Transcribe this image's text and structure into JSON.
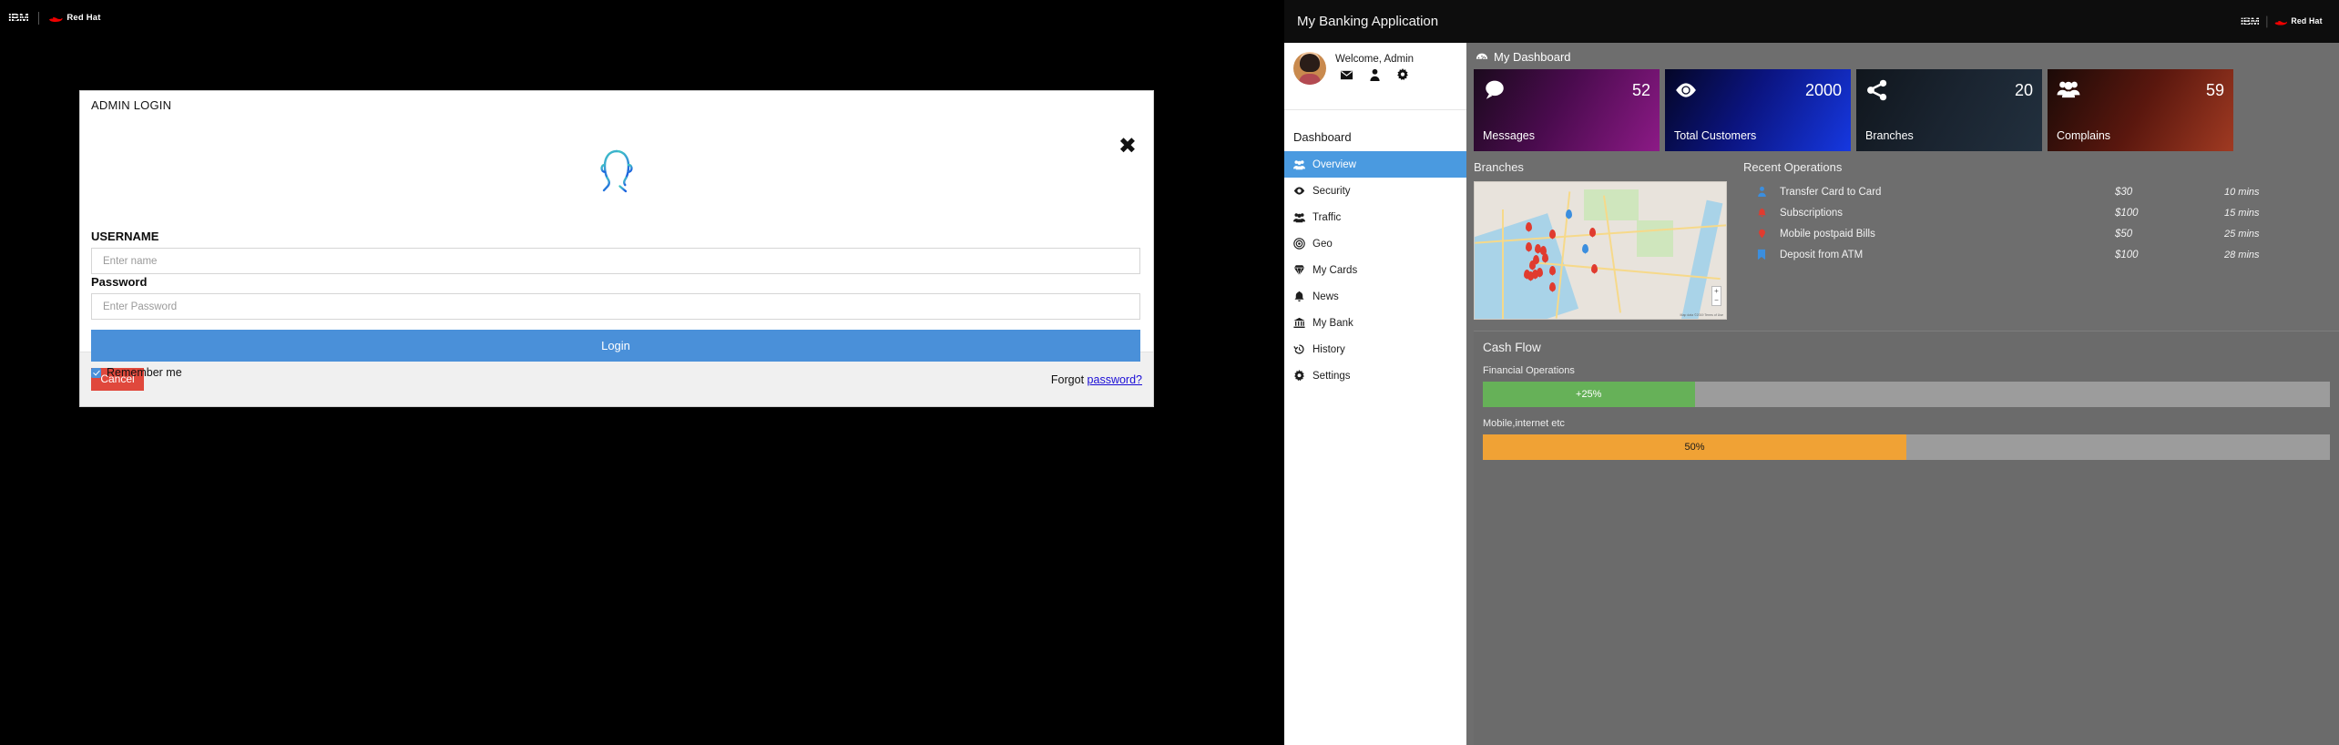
{
  "left_app": {
    "brand": {
      "ibm": "IBM",
      "redhat": "Red Hat"
    },
    "modal": {
      "title": "ADMIN LOGIN",
      "close_icon": "close-icon",
      "avatar_icon": "user-outline-icon",
      "username_label": "USERNAME",
      "username_value": "",
      "username_placeholder": "Enter name",
      "password_label": "Password",
      "password_value": "",
      "password_placeholder": "Enter Password",
      "login_label": "Login",
      "remember_label": "Remember me",
      "remember_checked": true,
      "cancel_label": "Cancel",
      "forgot_prefix": "Forgot",
      "forgot_link": "password?",
      "accent_blue": "#4a90d9",
      "cancel_red": "#e0483c",
      "link_blue": "#1a0dd6"
    }
  },
  "right_app": {
    "topbar": {
      "title": "My Banking Application",
      "ibm": "IBM",
      "redhat": "Red Hat"
    },
    "sidebar": {
      "welcome": "Welcome, Admin",
      "avatar": "avatar",
      "quick_icons": [
        "envelope-icon",
        "user-icon",
        "gear-icon"
      ],
      "section_title": "Dashboard",
      "items": [
        {
          "label": "Overview",
          "icon": "users-icon",
          "active": true
        },
        {
          "label": "Security",
          "icon": "eye-icon",
          "active": false
        },
        {
          "label": "Traffic",
          "icon": "users-icon",
          "active": false
        },
        {
          "label": "Geo",
          "icon": "target-icon",
          "active": false
        },
        {
          "label": "My Cards",
          "icon": "diamond-icon",
          "active": false
        },
        {
          "label": "News",
          "icon": "bell-icon",
          "active": false
        },
        {
          "label": "My Bank",
          "icon": "bank-icon",
          "active": false
        },
        {
          "label": "History",
          "icon": "history-icon",
          "active": false
        },
        {
          "label": "Settings",
          "icon": "gear-icon",
          "active": false
        }
      ]
    },
    "dashboard": {
      "header": "My Dashboard",
      "header_icon": "dashboard-icon",
      "cards": [
        {
          "label": "Messages",
          "value": "52",
          "icon": "speech-bubble-icon",
          "color": "#8c1a86"
        },
        {
          "label": "Total Customers",
          "value": "2000",
          "icon": "eye-icon",
          "color": "#1638e0"
        },
        {
          "label": "Branches",
          "value": "20",
          "icon": "share-icon",
          "color": "#22303e"
        },
        {
          "label": "Complains",
          "value": "59",
          "icon": "users-group-icon",
          "color": "#a03a22"
        }
      ],
      "branches": {
        "title": "Branches",
        "map_zoom_in": "+",
        "map_zoom_out": "−",
        "map_attribution": "Map data ©2019  Terms of Use"
      },
      "recent_operations": {
        "title": "Recent Operations",
        "rows": [
          {
            "icon": "user-icon",
            "icon_color": "#3b8ede",
            "name": "Transfer Card to Card",
            "amount": "$30",
            "time": "10 mins"
          },
          {
            "icon": "bell-icon",
            "icon_color": "#e03b2f",
            "name": "Subscriptions",
            "amount": "$100",
            "time": "15 mins"
          },
          {
            "icon": "pin-icon",
            "icon_color": "#e03b2f",
            "name": "Mobile postpaid Bills",
            "amount": "$50",
            "time": "25 mins"
          },
          {
            "icon": "bookmark-icon",
            "icon_color": "#3b8ede",
            "name": "Deposit from ATM",
            "amount": "$100",
            "time": "28 mins"
          }
        ]
      },
      "cash_flow": {
        "title": "Cash Flow",
        "bars": [
          {
            "label": "Financial Operations",
            "value_text": "+25%",
            "percent": 25,
            "color": "#66b158"
          },
          {
            "label": "Mobile,internet etc",
            "value_text": "50%",
            "percent": 50,
            "color": "#f0a235"
          }
        ]
      }
    }
  }
}
